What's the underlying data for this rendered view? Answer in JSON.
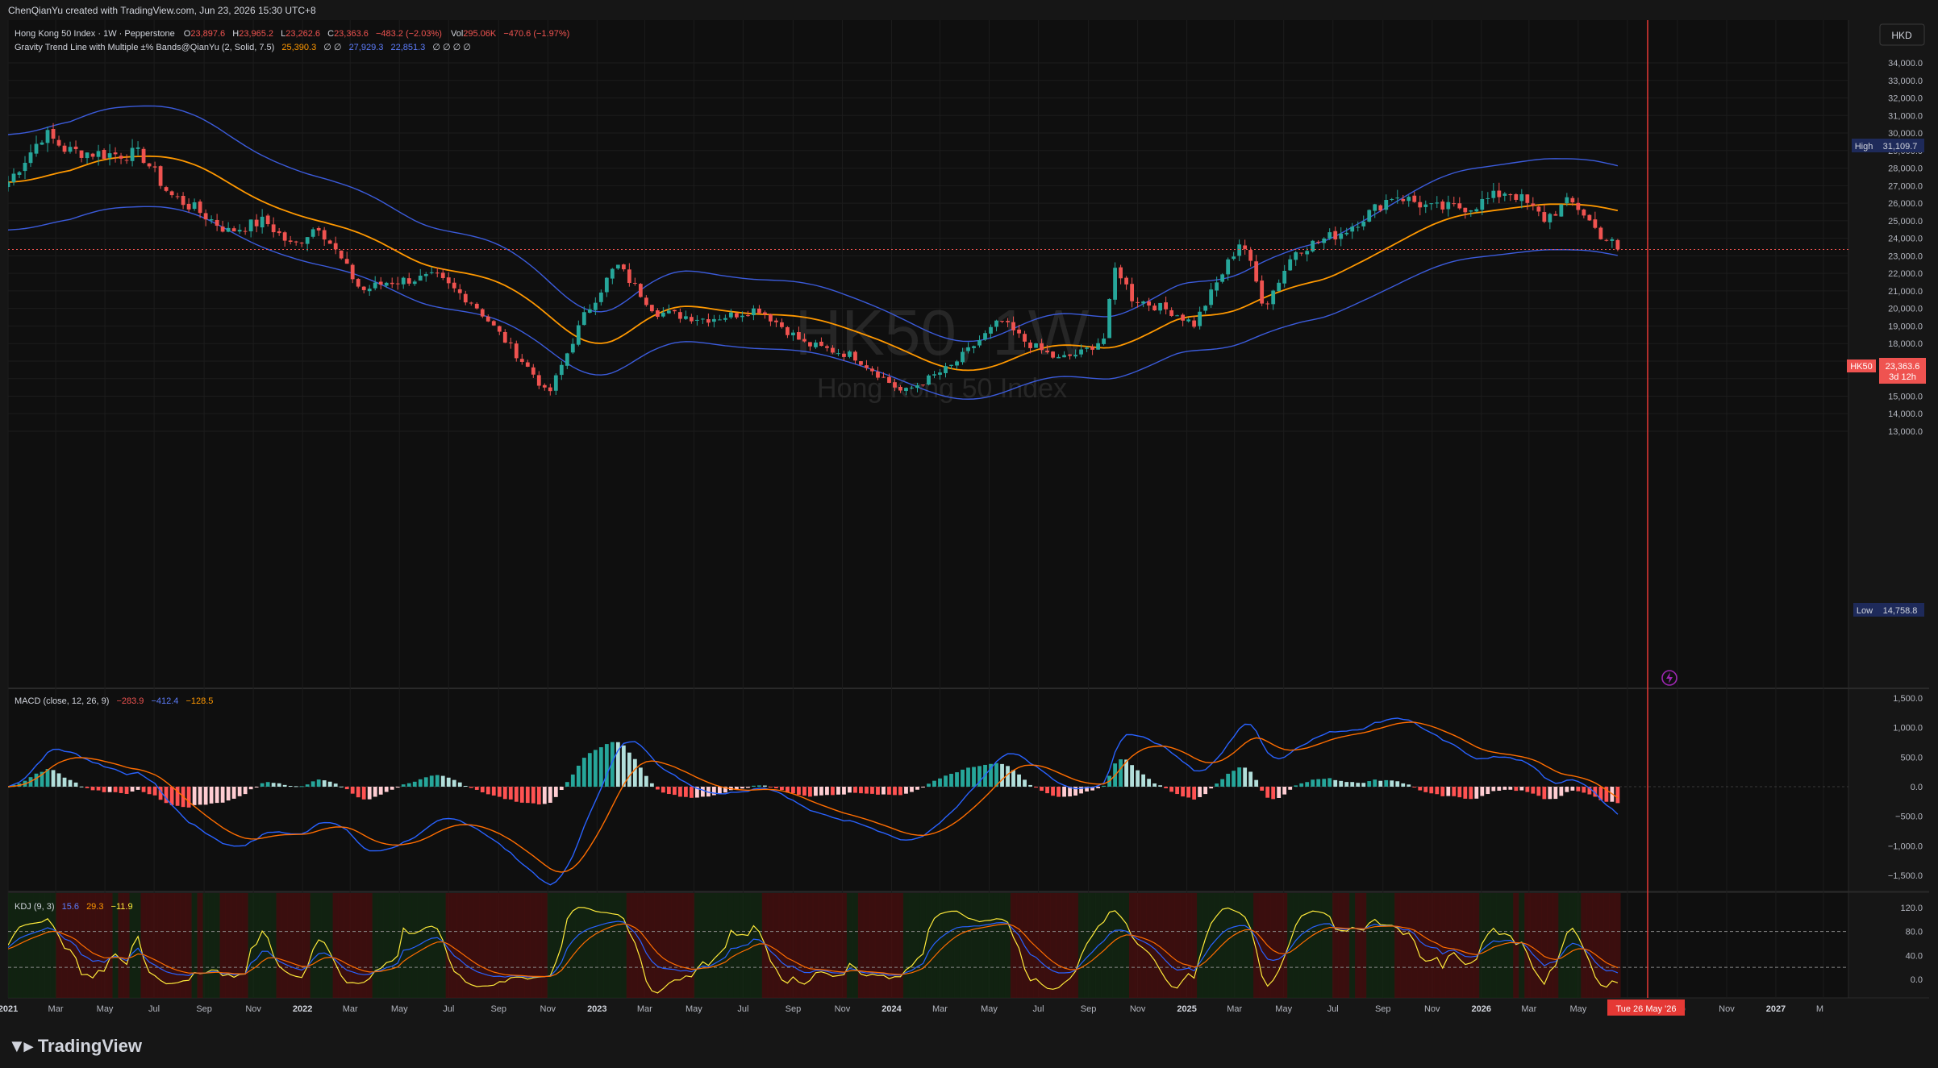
{
  "header": {
    "created_line": "ChenQianYu created with TradingView.com, Jun 23, 2026 15:30 UTC+8"
  },
  "legend": {
    "symbol": "Hong Kong 50 Index · 1W · Pepperstone",
    "o_label": "O",
    "o_value": "23,897.6",
    "h_label": "H",
    "h_value": "23,965.2",
    "l_label": "L",
    "l_value": "23,262.6",
    "c_label": "C",
    "c_value": "23,363.6",
    "change": "−483.2 (−2.03%)",
    "vol_label": "Vol",
    "vol_value": "295.06K",
    "vol_change": "−470.6 (−1.97%)",
    "indicator_name": "Gravity Trend Line with Multiple ±% Bands@QianYu (2, Solid, 7.5)",
    "ind_mid": "25,390.3",
    "ind_phi": "∅ ∅",
    "ind_up": "27,929.3",
    "ind_low": "22,851.3",
    "ind_tail": "∅ ∅ ∅ ∅"
  },
  "watermark": {
    "symbol": "HK50, 1W",
    "name": "Hong Kong 50 Index"
  },
  "currency_button": "HKD",
  "price_axis": [
    "34,000.0",
    "33,000.0",
    "32,000.0",
    "31,000.0",
    "30,000.0",
    "29,000.0",
    "28,000.0",
    "27,000.0",
    "26,000.0",
    "25,000.0",
    "24,000.0",
    "23,000.0",
    "22,000.0",
    "21,000.0",
    "20,000.0",
    "19,000.0",
    "18,000.0",
    "17,000.0",
    "16,000.0",
    "15,000.0",
    "14,000.0",
    "13,000.0"
  ],
  "high_tag": {
    "label": "High",
    "value": "31,109.7"
  },
  "low_tag": {
    "label": "Low",
    "value": "14,758.8"
  },
  "last_tag": {
    "symbol": "HK50",
    "value": "23,363.6",
    "countdown": "3d 12h"
  },
  "macd": {
    "title": "MACD (close, 12, 26, 9)",
    "v1": "−283.9",
    "v2": "−412.4",
    "v3": "−128.5",
    "axis": [
      "1,500.0",
      "1,000.0",
      "500.0",
      "0.0",
      "−500.0",
      "−1,000.0",
      "−1,500.0"
    ]
  },
  "kdj": {
    "title": "KDJ (9, 3)",
    "k": "15.6",
    "d": "29.3",
    "j": "−11.9",
    "axis": [
      "120.0",
      "80.0",
      "40.0",
      "0.0"
    ]
  },
  "time_axis": [
    "2021",
    "Mar",
    "May",
    "Jul",
    "Sep",
    "Nov",
    "2022",
    "Mar",
    "May",
    "Jul",
    "Sep",
    "Nov",
    "2023",
    "Mar",
    "May",
    "Jul",
    "Sep",
    "Nov",
    "2024",
    "Mar",
    "May",
    "Jul",
    "Sep",
    "Nov",
    "2025",
    "Mar",
    "May",
    "Jul",
    "Sep",
    "Nov",
    "2026",
    "Mar",
    "May",
    "Jul",
    "Sep",
    "Nov",
    "2027",
    "M"
  ],
  "cursor_date": "Tue 26 May '26",
  "footer_brand": "TradingView",
  "colors": {
    "up": "#26a69a",
    "down": "#ef5350",
    "band": "#3b5bdb",
    "mid": "#ff9800",
    "macd": "#2962ff",
    "signal": "#ff6d00",
    "kdj_k": "#ffeb3b",
    "kdj_d": "#2962ff",
    "kdj_j": "#ff6d00"
  },
  "chart_data": [
    {
      "type": "candlestick",
      "title": "HK50, 1W",
      "subtitle": "Hong Kong 50 Index",
      "ylim": [
        12500,
        34500
      ],
      "x_range": [
        "2021-01",
        "2027-04"
      ],
      "anchors_close": [
        [
          "2021-01-01",
          27200
        ],
        [
          "2021-02-15",
          30000
        ],
        [
          "2021-03-15",
          29000
        ],
        [
          "2021-05-01",
          28800
        ],
        [
          "2021-06-15",
          28800
        ],
        [
          "2021-07-20",
          26500
        ],
        [
          "2021-08-20",
          25700
        ],
        [
          "2021-10-01",
          24400
        ],
        [
          "2021-11-15",
          25000
        ],
        [
          "2021-12-20",
          23500
        ],
        [
          "2022-01-20",
          24800
        ],
        [
          "2022-03-15",
          21000
        ],
        [
          "2022-04-15",
          21500
        ],
        [
          "2022-06-15",
          21800
        ],
        [
          "2022-08-01",
          20300
        ],
        [
          "2022-10-15",
          16200
        ],
        [
          "2022-11-01",
          15000
        ],
        [
          "2022-12-15",
          19500
        ],
        [
          "2023-01-25",
          22500
        ],
        [
          "2023-03-15",
          19800
        ],
        [
          "2023-05-15",
          19400
        ],
        [
          "2023-06-15",
          19600
        ],
        [
          "2023-07-20",
          20000
        ],
        [
          "2023-09-15",
          18000
        ],
        [
          "2023-11-15",
          17300
        ],
        [
          "2024-01-15",
          15200
        ],
        [
          "2024-03-15",
          16700
        ],
        [
          "2024-05-15",
          19300
        ],
        [
          "2024-06-15",
          18100
        ],
        [
          "2024-07-25",
          17100
        ],
        [
          "2024-08-25",
          17500
        ],
        [
          "2024-09-20",
          18300
        ],
        [
          "2024-10-05",
          22500
        ],
        [
          "2024-10-25",
          20600
        ],
        [
          "2024-12-15",
          19800
        ],
        [
          "2025-01-10",
          19100
        ],
        [
          "2025-03-10",
          24000
        ],
        [
          "2025-04-07",
          20100
        ],
        [
          "2025-05-15",
          23300
        ],
        [
          "2025-07-15",
          24400
        ],
        [
          "2025-09-15",
          26500
        ],
        [
          "2025-11-01",
          25700
        ],
        [
          "2025-12-20",
          25800
        ],
        [
          "2026-02-01",
          26700
        ],
        [
          "2026-02-15",
          26400
        ],
        [
          "2026-03-20",
          25100
        ],
        [
          "2026-04-20",
          26100
        ],
        [
          "2026-05-05",
          25600
        ],
        [
          "2026-05-26",
          24300
        ],
        [
          "2026-06-23",
          23363.6
        ]
      ],
      "last_ohlc": {
        "open": 23897.6,
        "high": 23965.2,
        "low": 23262.6,
        "close": 23363.6
      },
      "period_high": 31109.7,
      "period_low": 14758.8,
      "series": [
        {
          "name": "Gravity Trend Line mid",
          "last": 25390.3
        },
        {
          "name": "Gravity Trend Line upper band",
          "last": 27929.3
        },
        {
          "name": "Gravity Trend Line lower band",
          "last": 22851.3
        }
      ]
    },
    {
      "type": "line",
      "title": "MACD (close, 12, 26, 9)",
      "ylim": [
        -1700,
        1700
      ],
      "series": [
        {
          "name": "MACD",
          "last": -412.4
        },
        {
          "name": "Signal",
          "last": -283.9
        },
        {
          "name": "Histogram",
          "last": -128.5
        }
      ]
    },
    {
      "type": "line",
      "title": "KDJ (9, 3)",
      "ylim": [
        -20,
        130
      ],
      "reference_levels": [
        80,
        20
      ],
      "series": [
        {
          "name": "K",
          "last": 15.6
        },
        {
          "name": "D",
          "last": 29.3
        },
        {
          "name": "J",
          "last": -11.9
        }
      ]
    }
  ]
}
